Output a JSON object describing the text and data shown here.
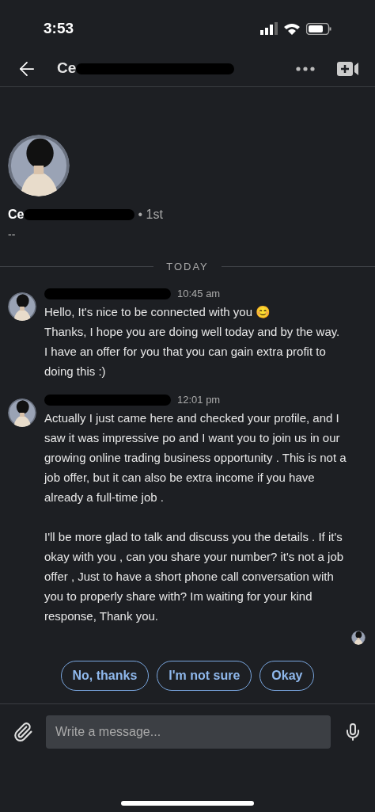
{
  "status_bar": {
    "time": "3:53"
  },
  "header": {
    "title": "Ce"
  },
  "profile": {
    "name": "Ce",
    "degree": "• 1st",
    "headline": "--"
  },
  "divider": {
    "label": "TODAY"
  },
  "messages": [
    {
      "time": "10:45 am",
      "paragraphs": [
        [
          "Hello, It's nice to be connected with you 😊",
          "Thanks, I hope you are doing well today and by the way.",
          "I have an offer for you that you can gain extra profit to doing this :)"
        ]
      ]
    },
    {
      "time": "12:01 pm",
      "paragraphs": [
        [
          "Actually I just came here and checked your profile, and I saw it was impressive po and I want you to join us in our growing online trading business opportunity . This is not a job offer, but it can also be extra income if you have already a full-time job ."
        ],
        [
          "I'll be more glad to talk and discuss you the details . If it's okay with you , can you share your number? it's not a job offer , Just to have a short phone call conversation with you to properly share with? Im waiting for your kind response, Thank you."
        ]
      ]
    }
  ],
  "quick_replies": [
    "No, thanks",
    "I'm not sure",
    "Okay"
  ],
  "composer": {
    "placeholder": "Write a message..."
  }
}
